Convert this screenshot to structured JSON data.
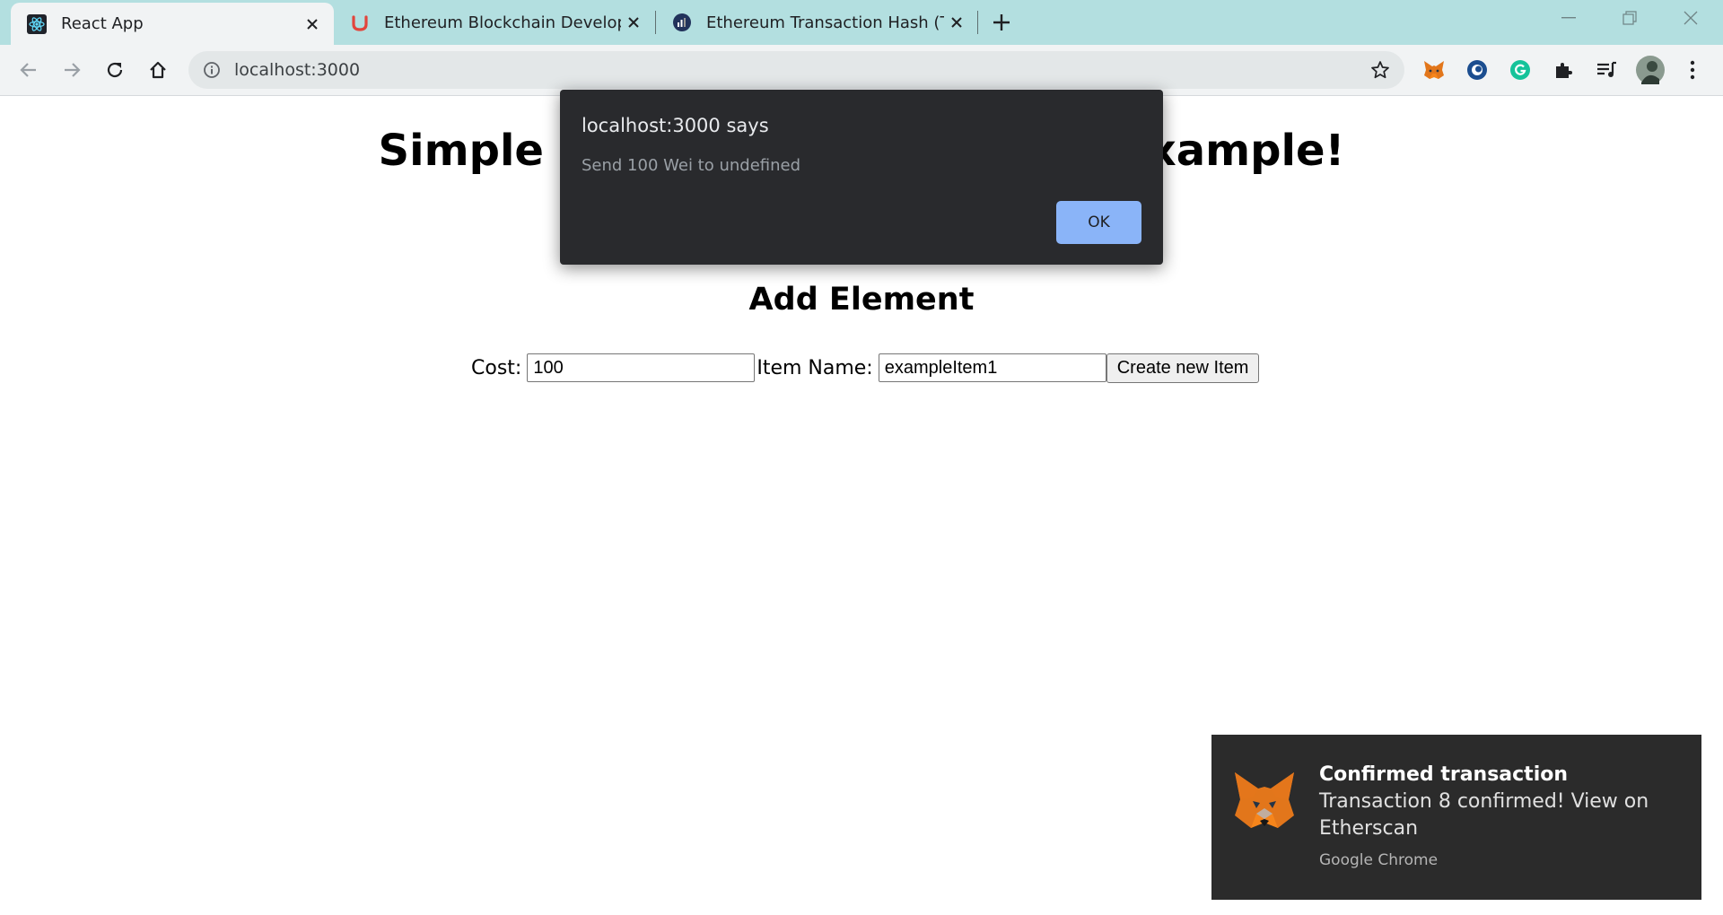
{
  "browser": {
    "tabs": [
      {
        "title": "React App",
        "icon": "react-icon",
        "active": true
      },
      {
        "title": "Ethereum Blockchain Developer B",
        "icon": "udemy-icon",
        "active": false
      },
      {
        "title": "Ethereum Transaction Hash (Txha",
        "icon": "etherscan-icon",
        "active": false
      }
    ],
    "address": "localhost:3000",
    "extensions": [
      "metamask-icon",
      "extension-eye-icon",
      "grammarly-icon",
      "puzzle-icon",
      "media-queue-icon",
      "profile-avatar",
      "more-menu-icon"
    ]
  },
  "page": {
    "title": "Simple Payment/Supply Chain Example!",
    "section_title": "Add Element",
    "form": {
      "cost_label": "Cost:",
      "cost_value": "100",
      "item_label": "Item Name:",
      "item_value": "exampleItem1",
      "submit_label": "Create new Item"
    }
  },
  "dialog": {
    "title": "localhost:3000 says",
    "message": "Send 100 Wei to undefined",
    "ok_label": "OK"
  },
  "notification": {
    "title": "Confirmed transaction",
    "body": "Transaction 8 confirmed! View on Etherscan",
    "source": "Google Chrome"
  },
  "colors": {
    "tabstrip": "#b3dfe0",
    "toolbar": "#f1f3f4",
    "dialog_bg": "#292a2d",
    "dialog_button": "#8ab4f8",
    "toast_bg": "#2b2b2b"
  }
}
